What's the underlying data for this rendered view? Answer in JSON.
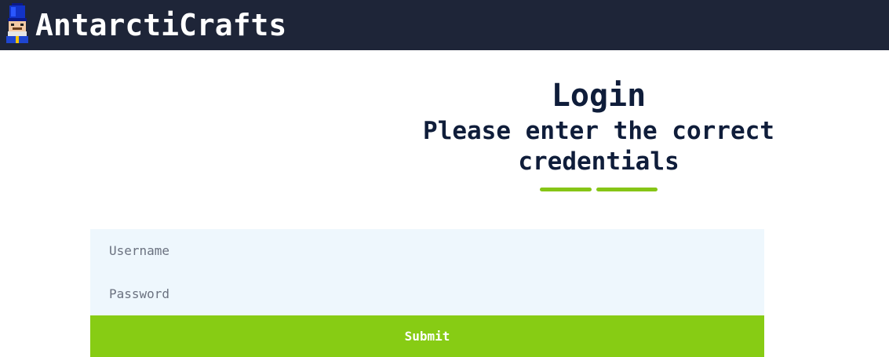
{
  "header": {
    "brand": "AntarctiCrafts",
    "logo_icon": "nutcracker-icon"
  },
  "login": {
    "title": "Login",
    "subtitle": "Please enter the correct credentials"
  },
  "form": {
    "username_placeholder": "Username",
    "password_placeholder": "Password",
    "submit_label": "Submit"
  },
  "colors": {
    "header_bg": "#1e2538",
    "heading_text": "#0f1d3a",
    "accent": "#86c516",
    "input_bg": "#eef7fd",
    "submit_bg": "#87cc14"
  }
}
